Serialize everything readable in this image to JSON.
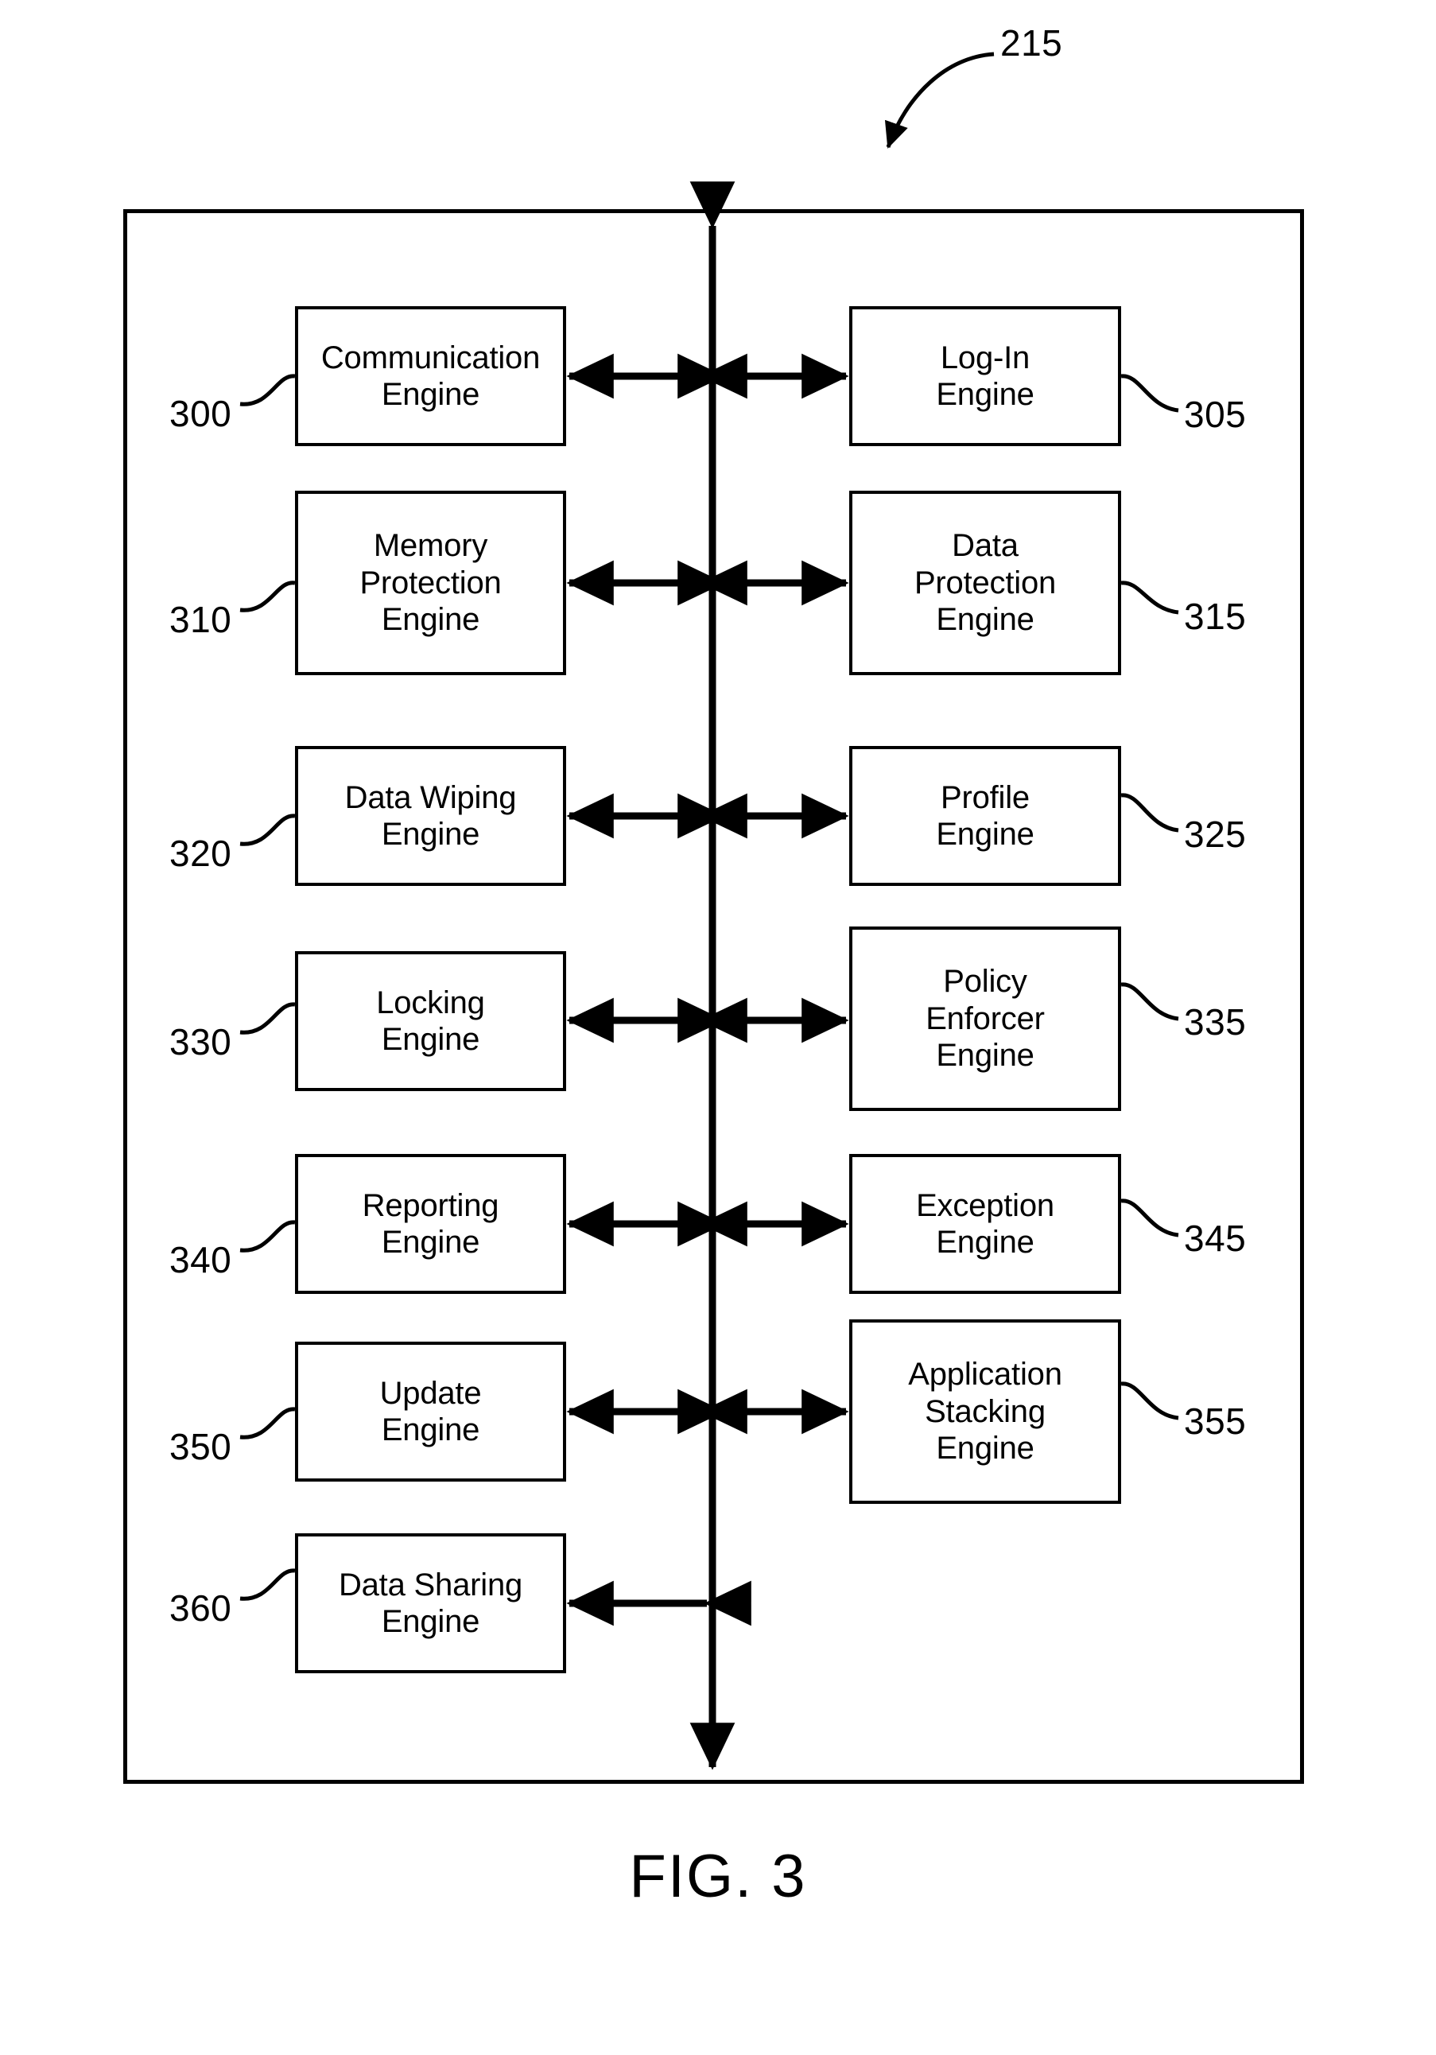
{
  "figure": {
    "caption": "FIG. 3",
    "system_ref": "215"
  },
  "engines": [
    {
      "ref": "300",
      "label": "Communication\nEngine",
      "side": "left",
      "row": 1
    },
    {
      "ref": "305",
      "label": "Log-In\nEngine",
      "side": "right",
      "row": 1
    },
    {
      "ref": "310",
      "label": "Memory\nProtection\nEngine",
      "side": "left",
      "row": 2
    },
    {
      "ref": "315",
      "label": "Data\nProtection\nEngine",
      "side": "right",
      "row": 2
    },
    {
      "ref": "320",
      "label": "Data Wiping\nEngine",
      "side": "left",
      "row": 3
    },
    {
      "ref": "325",
      "label": "Profile\nEngine",
      "side": "right",
      "row": 3
    },
    {
      "ref": "330",
      "label": "Locking\nEngine",
      "side": "left",
      "row": 4
    },
    {
      "ref": "335",
      "label": "Policy\nEnforcer\nEngine",
      "side": "right",
      "row": 4
    },
    {
      "ref": "340",
      "label": "Reporting\nEngine",
      "side": "left",
      "row": 5
    },
    {
      "ref": "345",
      "label": "Exception\nEngine",
      "side": "right",
      "row": 5
    },
    {
      "ref": "350",
      "label": "Update\nEngine",
      "side": "left",
      "row": 6
    },
    {
      "ref": "355",
      "label": "Application\nStacking\nEngine",
      "side": "right",
      "row": 6
    },
    {
      "ref": "360",
      "label": "Data Sharing\nEngine",
      "side": "left",
      "row": 7
    }
  ],
  "colors": {
    "stroke": "#000000",
    "background": "#ffffff"
  }
}
